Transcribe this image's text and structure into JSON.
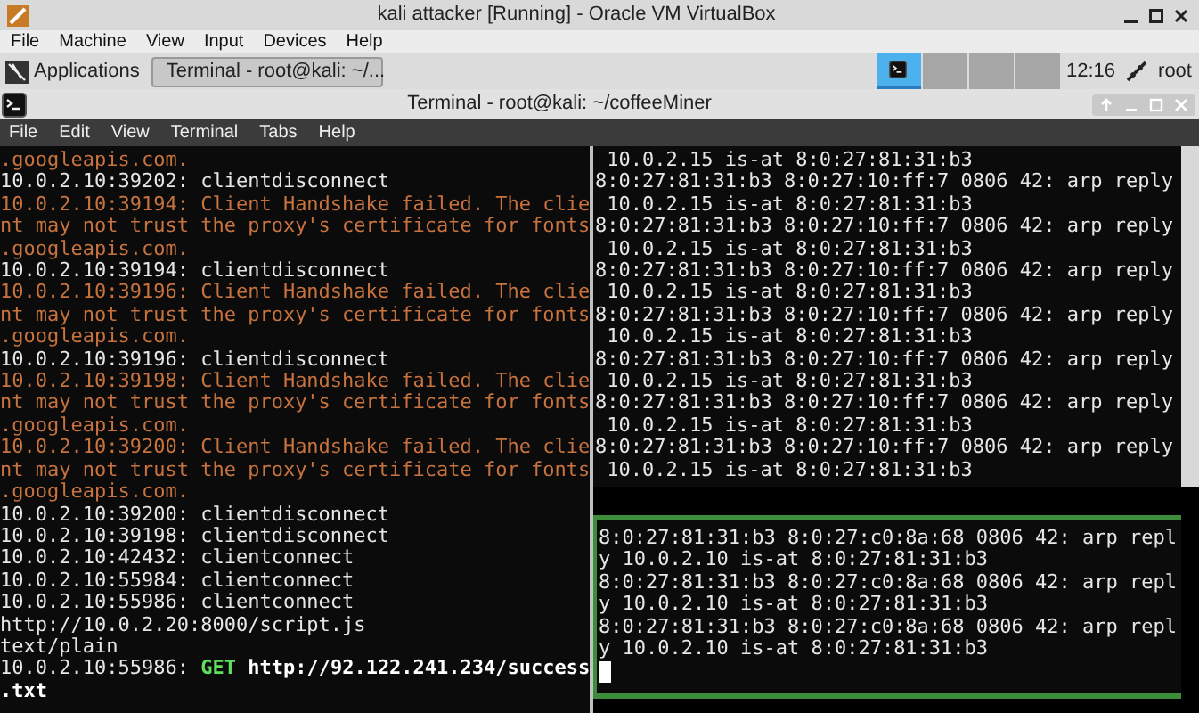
{
  "window": {
    "title": "kali attacker [Running] - Oracle VM VirtualBox"
  },
  "menu": [
    "File",
    "Machine",
    "View",
    "Input",
    "Devices",
    "Help"
  ],
  "panel": {
    "applications": "Applications",
    "task": {
      "label": "Terminal - root@kali: ~/...",
      "selected": true
    },
    "workspaces": [
      {
        "selected": true
      },
      {
        "selected": false
      },
      {
        "selected": false
      },
      {
        "selected": false
      }
    ],
    "clock": "12:16",
    "user": "root"
  },
  "terminal": {
    "title": "Terminal - root@kali: ~/coffeeMiner",
    "menu": [
      "File",
      "Edit",
      "View",
      "Terminal",
      "Tabs",
      "Help"
    ],
    "left_pane": {
      "lines": [
        [
          {
            "text": ".googleapis.com.",
            "kind": "error"
          }
        ],
        [
          {
            "text": "10.0.2.10:39202: clientdisconnect",
            "kind": "plain"
          }
        ],
        [
          {
            "text": "10.0.2.10:39194: Client Handshake failed. The clie",
            "kind": "error"
          }
        ],
        [
          {
            "text": "nt may not trust the proxy's certificate for fonts",
            "kind": "error"
          }
        ],
        [
          {
            "text": ".googleapis.com.",
            "kind": "error"
          }
        ],
        [
          {
            "text": "10.0.2.10:39194: clientdisconnect",
            "kind": "plain"
          }
        ],
        [
          {
            "text": "10.0.2.10:39196: Client Handshake failed. The clie",
            "kind": "error"
          }
        ],
        [
          {
            "text": "nt may not trust the proxy's certificate for fonts",
            "kind": "error"
          }
        ],
        [
          {
            "text": ".googleapis.com.",
            "kind": "error"
          }
        ],
        [
          {
            "text": "10.0.2.10:39196: clientdisconnect",
            "kind": "plain"
          }
        ],
        [
          {
            "text": "10.0.2.10:39198: Client Handshake failed. The clie",
            "kind": "error"
          }
        ],
        [
          {
            "text": "nt may not trust the proxy's certificate for fonts",
            "kind": "error"
          }
        ],
        [
          {
            "text": ".googleapis.com.",
            "kind": "error"
          }
        ],
        [
          {
            "text": "10.0.2.10:39200: Client Handshake failed. The clie",
            "kind": "error"
          }
        ],
        [
          {
            "text": "nt may not trust the proxy's certificate for fonts",
            "kind": "error"
          }
        ],
        [
          {
            "text": ".googleapis.com.",
            "kind": "error"
          }
        ],
        [
          {
            "text": "10.0.2.10:39200: clientdisconnect",
            "kind": "plain"
          }
        ],
        [
          {
            "text": "10.0.2.10:39198: clientdisconnect",
            "kind": "plain"
          }
        ],
        [
          {
            "text": "10.0.2.10:42432: clientconnect",
            "kind": "plain"
          }
        ],
        [
          {
            "text": "10.0.2.10:55984: clientconnect",
            "kind": "plain"
          }
        ],
        [
          {
            "text": "10.0.2.10:55986: clientconnect",
            "kind": "plain"
          }
        ],
        [
          {
            "text": "http://10.0.2.20:8000/script.js",
            "kind": "plain"
          }
        ],
        [
          {
            "text": "text/plain",
            "kind": "plain"
          }
        ],
        [
          {
            "text": "10.0.2.10:55986: ",
            "kind": "plain"
          },
          {
            "text": "GET",
            "kind": "method"
          },
          {
            "text": " http://92.122.241.234/success",
            "kind": "url"
          }
        ],
        [
          {
            "text": ".txt",
            "kind": "url"
          }
        ]
      ]
    },
    "right_pane": {
      "lines": [
        " 10.0.2.15 is-at 8:0:27:81:31:b3",
        "8:0:27:81:31:b3 8:0:27:10:ff:7 0806 42: arp reply",
        " 10.0.2.15 is-at 8:0:27:81:31:b3",
        "8:0:27:81:31:b3 8:0:27:10:ff:7 0806 42: arp reply",
        " 10.0.2.15 is-at 8:0:27:81:31:b3",
        "8:0:27:81:31:b3 8:0:27:10:ff:7 0806 42: arp reply",
        " 10.0.2.15 is-at 8:0:27:81:31:b3",
        "8:0:27:81:31:b3 8:0:27:10:ff:7 0806 42: arp reply",
        " 10.0.2.15 is-at 8:0:27:81:31:b3",
        "8:0:27:81:31:b3 8:0:27:10:ff:7 0806 42: arp reply",
        " 10.0.2.15 is-at 8:0:27:81:31:b3",
        "8:0:27:81:31:b3 8:0:27:10:ff:7 0806 42: arp reply",
        " 10.0.2.15 is-at 8:0:27:81:31:b3",
        "8:0:27:81:31:b3 8:0:27:10:ff:7 0806 42: arp reply",
        " 10.0.2.15 is-at 8:0:27:81:31:b3"
      ]
    },
    "active_pane": {
      "focused": true,
      "cursor": true,
      "lines": [
        "8:0:27:81:31:b3 8:0:27:c0:8a:68 0806 42: arp repl",
        "y 10.0.2.10 is-at 8:0:27:81:31:b3",
        "8:0:27:81:31:b3 8:0:27:c0:8a:68 0806 42: arp repl",
        "y 10.0.2.10 is-at 8:0:27:81:31:b3",
        "8:0:27:81:31:b3 8:0:27:c0:8a:68 0806 42: arp repl",
        "y 10.0.2.10 is-at 8:0:27:81:31:b3"
      ]
    }
  }
}
